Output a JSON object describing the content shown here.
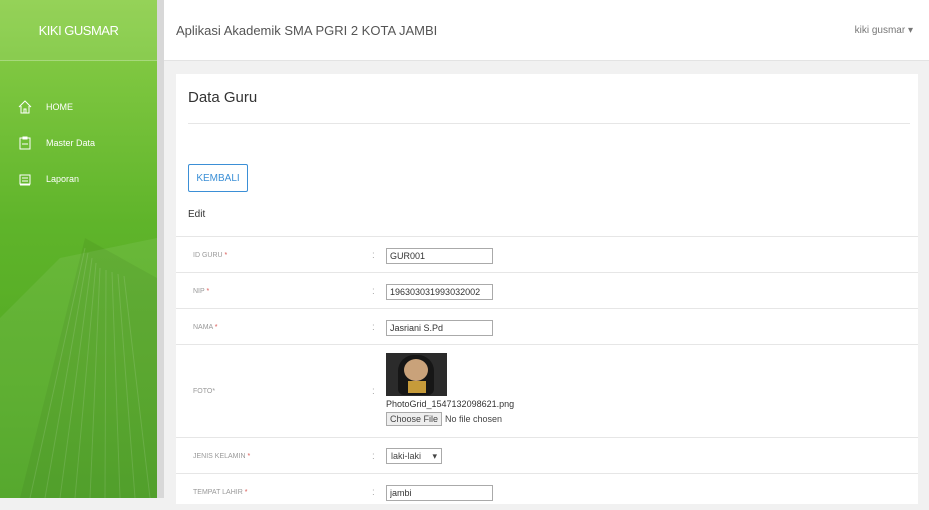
{
  "sidebar": {
    "brand": "KIKI GUSMAR",
    "items": [
      {
        "label": "HOME",
        "icon": "home-icon"
      },
      {
        "label": "Master Data",
        "icon": "clipboard-icon"
      },
      {
        "label": "Laporan",
        "icon": "report-icon"
      }
    ]
  },
  "header": {
    "app_title": "Aplikasi Akademik SMA PGRI 2 KOTA JAMBI",
    "user": "kiki gusmar"
  },
  "page": {
    "title": "Data Guru",
    "back_button": "KEMBALI",
    "section": "Edit"
  },
  "form": {
    "id_guru": {
      "label": "ID GURU",
      "value": "GUR001"
    },
    "nip": {
      "label": "NIP",
      "value": "196303031993032002"
    },
    "nama": {
      "label": "NAMA",
      "value": "Jasriani S.Pd"
    },
    "foto": {
      "label": "FOTO*",
      "filename": "PhotoGrid_1547132098621.png",
      "choose_label": "Choose File",
      "no_file": "No file chosen"
    },
    "jenis_kelamin": {
      "label": "JENIS KELAMIN",
      "value": "laki-laki"
    },
    "tempat_lahir": {
      "label": "TEMPAT LAHIR",
      "value": "jambi"
    },
    "required_mark": "*",
    "colon": ":"
  },
  "colors": {
    "sidebar": "#5fb42a",
    "accent": "#3b8fd6",
    "required": "#d9534f"
  }
}
